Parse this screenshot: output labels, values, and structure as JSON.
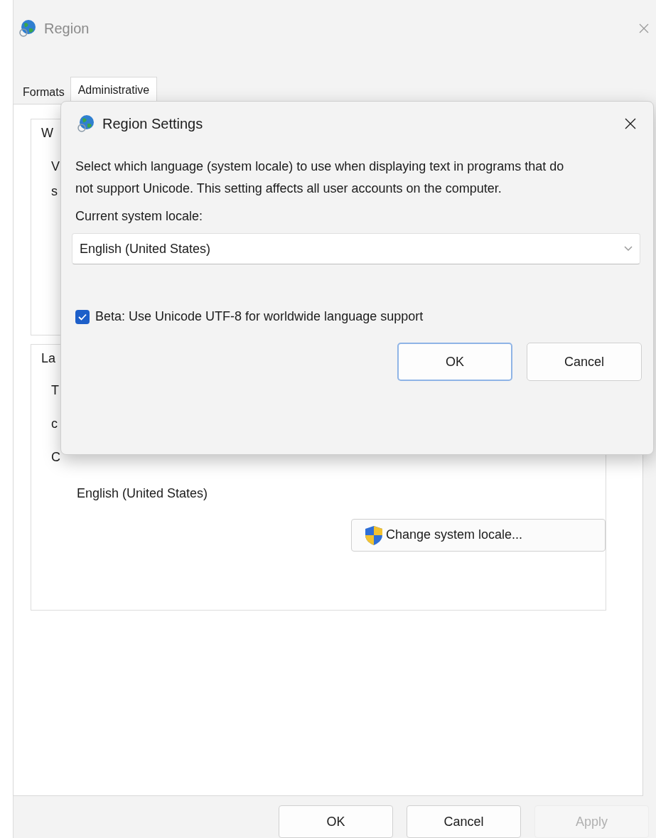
{
  "window": {
    "title": "Region"
  },
  "tabs": [
    {
      "label": "Formats",
      "selected": false
    },
    {
      "label": "Administrative",
      "selected": true
    }
  ],
  "groups": [
    {
      "label": "W",
      "lines": [
        "V",
        "s"
      ]
    },
    {
      "label": "La",
      "lines": [
        "T",
        "c",
        "C"
      ],
      "value": "English (United States)",
      "button": "Change system locale..."
    }
  ],
  "buttons": [
    {
      "label": "OK",
      "disabled": false
    },
    {
      "label": "Cancel",
      "disabled": false
    },
    {
      "label": "Apply",
      "disabled": true
    }
  ],
  "dialog": {
    "title": "Region Settings",
    "description": "Select which language (system locale) to use when displaying text in programs that do not support Unicode. This setting affects all user accounts on the computer.",
    "locale_label": "Current system locale:",
    "locale_value": "English (United States)",
    "checkbox": {
      "label": "Beta: Use Unicode UTF-8 for worldwide language support",
      "checked": true
    },
    "buttons": [
      {
        "label": "OK",
        "default": true
      },
      {
        "label": "Cancel",
        "default": false
      }
    ]
  }
}
